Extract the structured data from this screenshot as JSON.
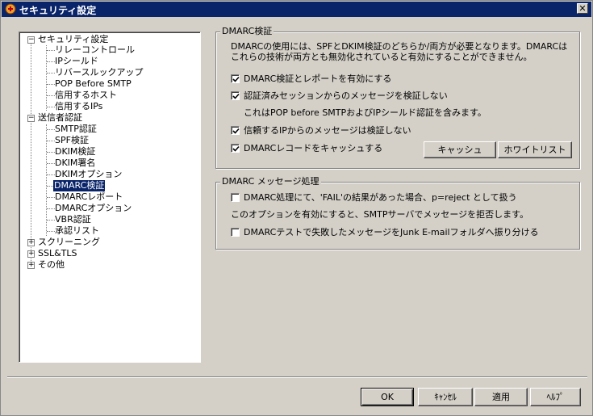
{
  "window": {
    "title": "セキュリティ設定",
    "close": "✕"
  },
  "tree": {
    "items": [
      {
        "label": "セキュリティ設定"
      },
      {
        "label": "リレーコントロール"
      },
      {
        "label": "IPシールド"
      },
      {
        "label": "リバースルックアップ"
      },
      {
        "label": "POP Before SMTP"
      },
      {
        "label": "信用するホスト"
      },
      {
        "label": "信用するIPs"
      },
      {
        "label": "送信者認証"
      },
      {
        "label": "SMTP認証"
      },
      {
        "label": "SPF検証"
      },
      {
        "label": "DKIM検証"
      },
      {
        "label": "DKIM署名"
      },
      {
        "label": "DKIMオプション"
      },
      {
        "label": "DMARC検証"
      },
      {
        "label": "DMARCレポート"
      },
      {
        "label": "DMARCオプション"
      },
      {
        "label": "VBR認証"
      },
      {
        "label": "承認リスト"
      },
      {
        "label": "スクリーニング"
      },
      {
        "label": "SSL&TLS"
      },
      {
        "label": "その他"
      }
    ],
    "expand_minus": "−",
    "expand_plus": "+"
  },
  "dmarc_verify": {
    "title": "DMARC検証",
    "desc1": "DMARCの使用には、SPFとDKIM検証のどちらか/両方が必要となります。DMARCは",
    "desc2": "これらの技術が両方とも無効化されていると有効にすることができません。",
    "opt_enable": {
      "label": "DMARC検証とレポートを有効にする",
      "checked": true
    },
    "opt_skip_auth": {
      "label": "認証済みセッションからのメッセージを検証しない",
      "checked": true
    },
    "note_auth": "これはPOP before SMTPおよびIPシールド認証を含みます。",
    "opt_trusted_ip": {
      "label": "信頼するIPからのメッセージは検証しない",
      "checked": true
    },
    "opt_cache": {
      "label": "DMARCレコードをキャッシュする",
      "checked": true
    },
    "btn_cache": "キャッシュ",
    "btn_whitelist": "ホワイトリスト"
  },
  "dmarc_message": {
    "title": "DMARC メッセージ処理",
    "opt_reject": {
      "label": "DMARC処理にて、'FAIL'の結果があった場合、p=reject として扱う",
      "checked": false
    },
    "note_reject": "このオプションを有効にすると、SMTPサーバでメッセージを拒否します。",
    "opt_junk": {
      "label": "DMARCテストで失敗したメッセージをJunk E-mailフォルダへ振り分ける",
      "checked": false
    }
  },
  "footer": {
    "ok": "OK",
    "cancel": "ｷｬﾝｾﾙ",
    "apply": "適用",
    "help": "ﾍﾙﾌﾟ"
  },
  "colors": {
    "titlebar": "#0a246a",
    "face": "#d4d0c8",
    "selection": "#0a246a"
  }
}
